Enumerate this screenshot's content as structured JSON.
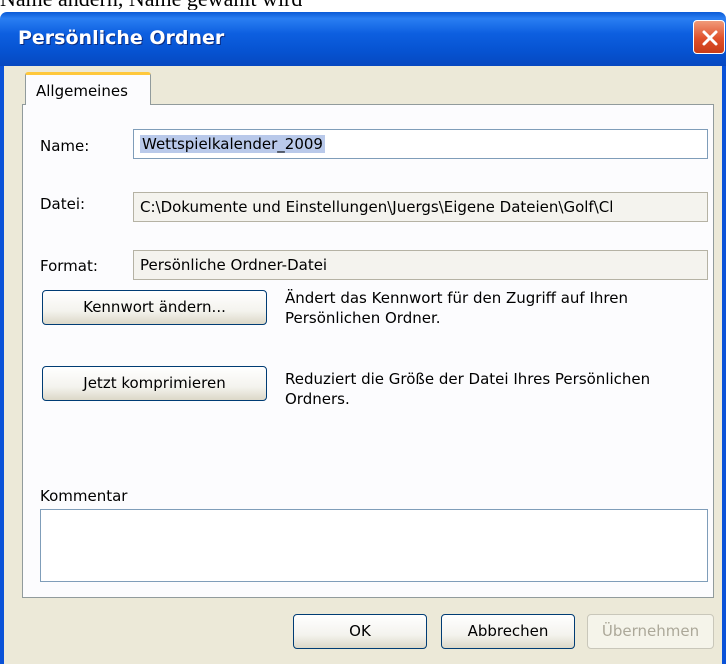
{
  "window": {
    "title": "Persönliche Ordner"
  },
  "above_text": "Name andern, Name gewählt wird",
  "tabs": [
    {
      "label": "Allgemeines"
    }
  ],
  "form": {
    "name": {
      "label": "Name:",
      "value": "Wettspielkalender_2009"
    },
    "datei": {
      "label": "Datei:",
      "value": "C:\\Dokumente und Einstellungen\\Juergs\\Eigene Dateien\\Golf\\Cl"
    },
    "format": {
      "label": "Format:",
      "value": "Persönliche Ordner-Datei"
    }
  },
  "actions": {
    "password": {
      "label": "Kennwort ändern...",
      "description_line1": "Ändert das Kennwort für den Zugriff auf Ihren",
      "description_line2": "Persönlichen Ordner."
    },
    "compact": {
      "label": "Jetzt komprimieren",
      "description_line1": "Reduziert die Größe der Datei Ihres Persönlichen",
      "description_line2": "Ordners."
    }
  },
  "comment": {
    "label": "Kommentar",
    "value": ""
  },
  "footer": {
    "ok": "OK",
    "cancel": "Abbrechen",
    "apply": "Übernehmen"
  },
  "colors": {
    "titlebar": "#0a52d8",
    "dialog_bg": "#ece9d8",
    "close_button": "#e0502a",
    "tab_highlight": "#ffc83c"
  }
}
